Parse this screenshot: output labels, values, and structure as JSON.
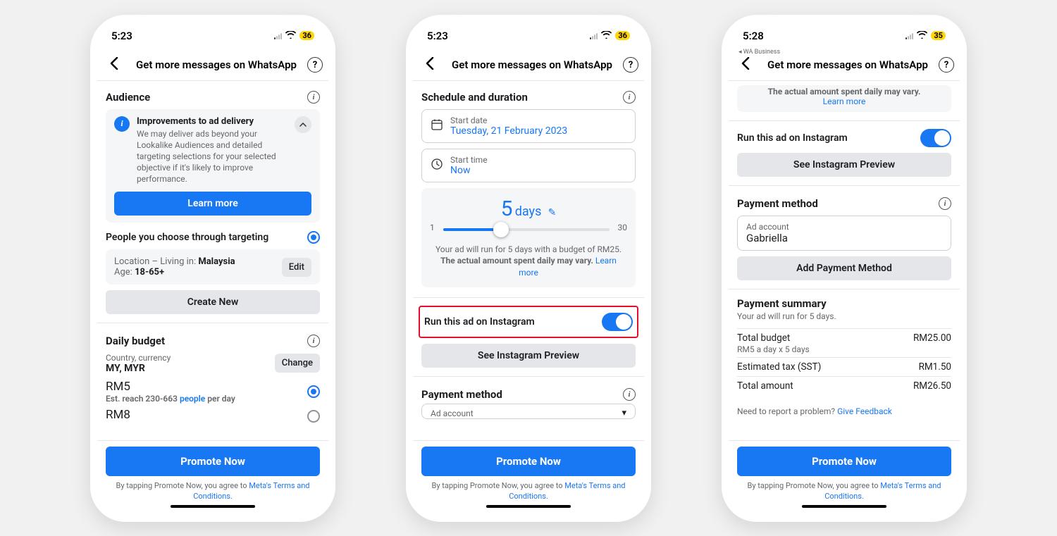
{
  "screens": [
    {
      "time": "5:23",
      "battery": "36",
      "sub_app": "",
      "title": "Get more messages on WhatsApp"
    },
    {
      "time": "5:23",
      "battery": "36",
      "sub_app": "",
      "title": "Get more messages on WhatsApp"
    },
    {
      "time": "5:28",
      "battery": "35",
      "sub_app": "◂ WA Business",
      "title": "Get more messages on WhatsApp"
    }
  ],
  "s1": {
    "audience": "Audience",
    "improve_title": "Improvements to ad delivery",
    "improve_body": "We may deliver ads beyond your Lookalike Audiences and detailed targeting selections for your selected objective if it's likely to improve performance.",
    "learn_more": "Learn more",
    "targeting_option": "People you choose through targeting",
    "location_label": "Location – Living in:",
    "location_value": "Malaysia",
    "age_label": "Age:",
    "age_value": "18-65+",
    "edit": "Edit",
    "create_new": "Create New",
    "daily_budget": "Daily budget",
    "country_currency_label": "Country, currency",
    "country_currency_value": "MY, MYR",
    "change": "Change",
    "opt1_price": "RM5",
    "opt1_reach_prefix": "Est. reach 230-663 ",
    "opt1_reach_link": "people",
    "opt1_reach_suffix": " per day",
    "opt2_price": "RM8"
  },
  "s2": {
    "schedule": "Schedule and duration",
    "start_date_label": "Start date",
    "start_date_value": "Tuesday, 21 February 2023",
    "start_time_label": "Start time",
    "start_time_value": "Now",
    "days_num": "5",
    "days_word": "days",
    "slider_min": "1",
    "slider_max": "30",
    "run_msg_1": "Your ad will run for 5 days with a budget of RM25.",
    "run_msg_2a": "The actual amount spent daily may vary. ",
    "run_msg_link": "Learn more",
    "ig_label": "Run this ad on Instagram",
    "ig_preview": "See Instagram Preview",
    "payment_method": "Payment method",
    "ad_account_label": "Ad account"
  },
  "s3": {
    "top_note_a": "The actual amount spent daily may vary. ",
    "top_note_link": "Learn more",
    "ig_label": "Run this ad on Instagram",
    "ig_preview": "See Instagram Preview",
    "payment_method": "Payment method",
    "ad_account_label": "Ad account",
    "ad_account_value": "Gabriella",
    "add_payment": "Add Payment Method",
    "summary_title": "Payment summary",
    "summary_sub": "Your ad will run for 5 days.",
    "row1_l": "Total budget",
    "row1_r": "RM25.00",
    "row1_sub": "RM5 a day x 5 days",
    "row2_l": "Estimated tax (SST)",
    "row2_r": "RM1.50",
    "row3_l": "Total amount",
    "row3_r": "RM26.50",
    "feedback_q": "Need to report a problem? ",
    "feedback_link": "Give Feedback"
  },
  "footer": {
    "promote": "Promote Now",
    "agree_prefix": "By tapping Promote Now, you agree to ",
    "agree_link": "Meta's Terms and Conditions",
    "agree_suffix": "."
  }
}
